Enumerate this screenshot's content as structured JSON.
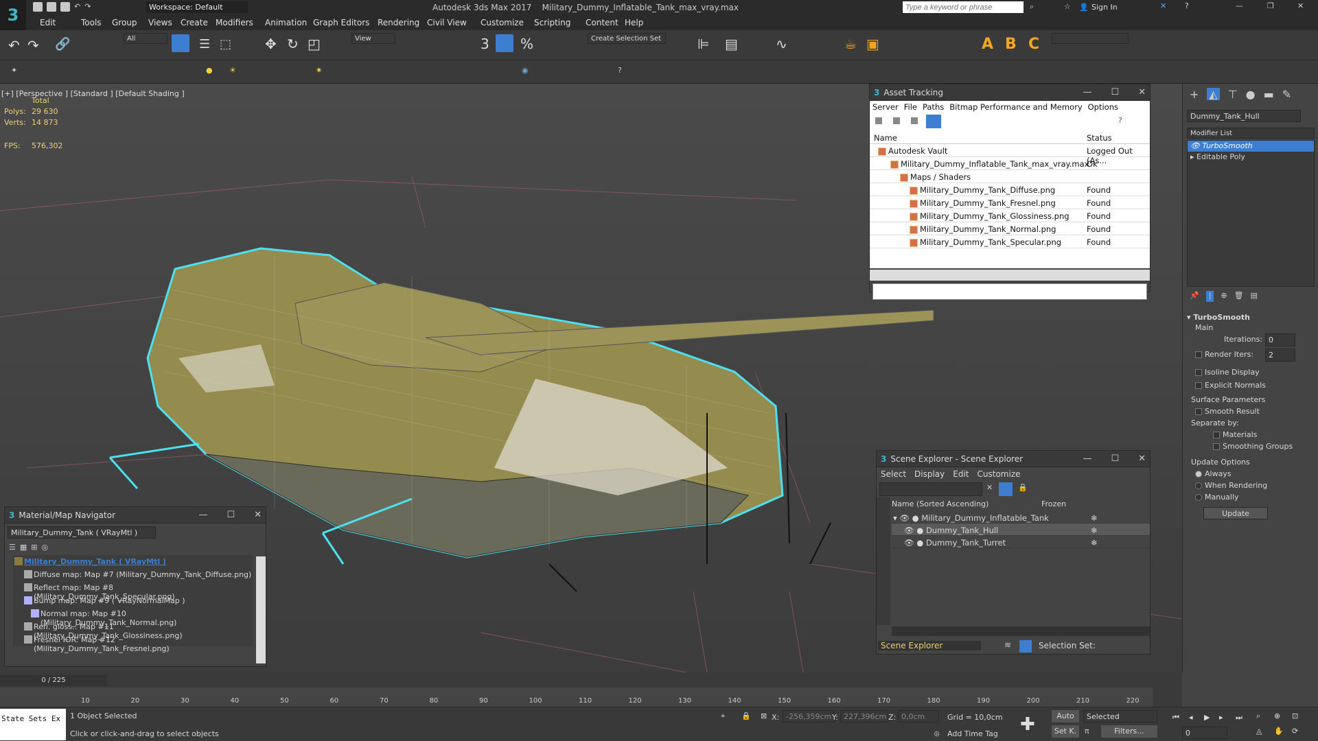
{
  "app": {
    "title": "Autodesk 3ds Max 2017",
    "file": "Military_Dummy_Inflatable_Tank_max_vray.max",
    "workspace": "Workspace: Default",
    "search_placeholder": "Type a keyword or phrase",
    "sign_in": "Sign In"
  },
  "menu": [
    "Edit",
    "Tools",
    "Group",
    "Views",
    "Create",
    "Modifiers",
    "Animation",
    "Graph Editors",
    "Rendering",
    "Civil View",
    "Customize",
    "Scripting",
    "Content",
    "Help"
  ],
  "toolbar": {
    "filter": "All",
    "view": "View",
    "selection_set": "Create Selection Set"
  },
  "viewport": {
    "label": "[+] [Perspective ] [Standard ] [Default Shading ]",
    "stats_total": "Total",
    "polys_label": "Polys:",
    "polys": "29 630",
    "verts_label": "Verts:",
    "verts": "14 873",
    "fps_label": "FPS:",
    "fps": "576,302"
  },
  "asset_tracking": {
    "title": "Asset Tracking",
    "menu": [
      "Server",
      "File",
      "Paths",
      "Bitmap Performance and Memory",
      "Options"
    ],
    "col_name": "Name",
    "col_status": "Status",
    "rows": [
      {
        "name": "Autodesk Vault",
        "status": "Logged Out (As..."
      },
      {
        "name": "Military_Dummy_Inflatable_Tank_max_vray.max",
        "status": "Ok"
      },
      {
        "name": "Maps / Shaders",
        "status": ""
      },
      {
        "name": "Military_Dummy_Tank_Diffuse.png",
        "status": "Found"
      },
      {
        "name": "Military_Dummy_Tank_Fresnel.png",
        "status": "Found"
      },
      {
        "name": "Military_Dummy_Tank_Glossiness.png",
        "status": "Found"
      },
      {
        "name": "Military_Dummy_Tank_Normal.png",
        "status": "Found"
      },
      {
        "name": "Military_Dummy_Tank_Specular.png",
        "status": "Found"
      }
    ]
  },
  "scene_explorer": {
    "title": "Scene Explorer - Scene Explorer",
    "menu": [
      "Select",
      "Display",
      "Edit",
      "Customize"
    ],
    "col_name": "Name (Sorted Ascending)",
    "col_frozen": "Frozen",
    "items": [
      "Military_Dummy_Inflatable_Tank",
      "Dummy_Tank_Hull",
      "Dummy_Tank_Turret"
    ],
    "footer": "Scene Explorer",
    "selection_set": "Selection Set:"
  },
  "material_nav": {
    "title": "Material/Map Navigator",
    "field": "Military_Dummy_Tank  ( VRayMtl )",
    "items": [
      "Military_Dummy_Tank  ( VRayMtl )",
      "Diffuse map: Map #7 (Military_Dummy_Tank_Diffuse.png)",
      "Reflect map: Map #8 (Military_Dummy_Tank_Specular.png)",
      "Bump map: Map #9  ( VRayNormalMap )",
      "Normal map: Map #10 (Military_Dummy_Tank_Normal.png)",
      "Refl. gloss.: Map #11 (Military_Dummy_Tank_Glossiness.png)",
      "Fresnel IOR: Map #12 (Military_Dummy_Tank_Fresnel.png)"
    ]
  },
  "command_panel": {
    "object_name": "Dummy_Tank_Hull",
    "modifier_list": "Modifier List",
    "stack": [
      "TurboSmooth",
      "Editable Poly"
    ],
    "rollout": "TurboSmooth",
    "main": "Main",
    "iterations_label": "Iterations:",
    "iterations": "0",
    "render_iters_label": "Render Iters:",
    "render_iters": "2",
    "isoline": "Isoline Display",
    "explicit": "Explicit Normals",
    "surface": "Surface Parameters",
    "smooth": "Smooth Result",
    "separate": "Separate by:",
    "materials": "Materials",
    "smoothing": "Smoothing Groups",
    "update_options": "Update Options",
    "always": "Always",
    "when_rendering": "When Rendering",
    "manually": "Manually",
    "update": "Update"
  },
  "timeline": {
    "frame": "0 / 225",
    "ticks": [
      "10",
      "20",
      "30",
      "40",
      "50",
      "60",
      "70",
      "80",
      "90",
      "100",
      "110",
      "120",
      "130",
      "140",
      "150",
      "160",
      "170",
      "180",
      "190",
      "200",
      "210",
      "220"
    ]
  },
  "status": {
    "state_sets": "State Sets Ex",
    "selected": "1 Object Selected",
    "hint": "Click or click-and-drag to select objects",
    "x_label": "X:",
    "x": "-256,359cm",
    "y_label": "Y:",
    "y": "227,396cm",
    "z_label": "Z:",
    "z": "0,0cm",
    "grid": "Grid = 10,0cm",
    "add_time_tag": "Add Time Tag",
    "auto": "Auto",
    "set_k": "Set K.",
    "selected_dd": "Selected",
    "filters": "Filters...",
    "frame_field": "0"
  },
  "colors": {
    "accent": "#3fb8c9",
    "highlight": "#3d7ed1",
    "stats": "#f0d070"
  }
}
